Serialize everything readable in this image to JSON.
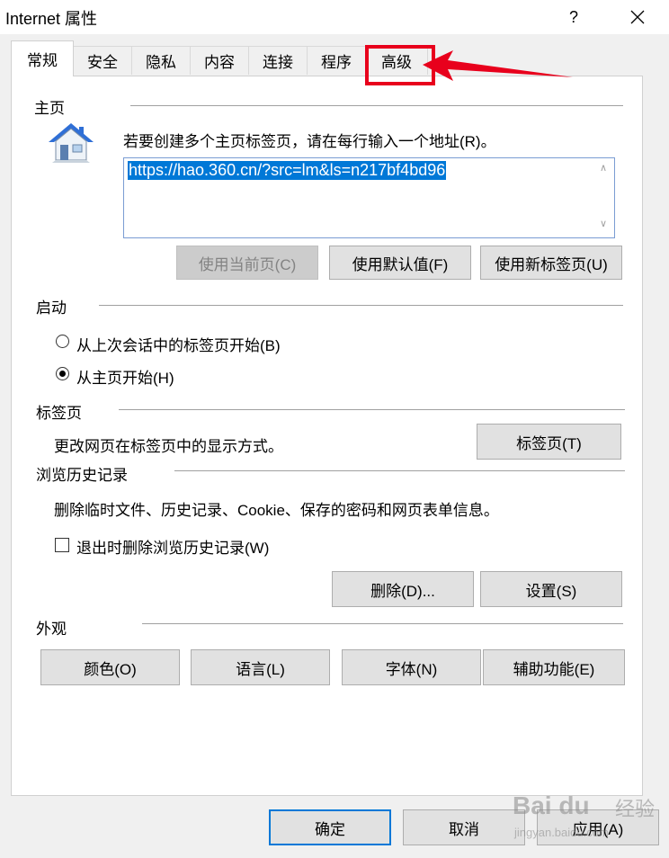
{
  "window": {
    "title": "Internet 属性",
    "help_label": "?"
  },
  "tabs": [
    {
      "label": "常规",
      "active": true
    },
    {
      "label": "安全"
    },
    {
      "label": "隐私"
    },
    {
      "label": "内容"
    },
    {
      "label": "连接"
    },
    {
      "label": "程序"
    },
    {
      "label": "高级"
    }
  ],
  "home": {
    "section_label": "主页",
    "instruction": "若要创建多个主页标签页，请在每行输入一个地址(R)。",
    "url_value": "https://hao.360.cn/?src=lm&ls=n217bf4bd96",
    "use_current_label": "使用当前页(C)",
    "use_default_label": "使用默认值(F)",
    "use_new_tab_label": "使用新标签页(U)"
  },
  "startup": {
    "section_label": "启动",
    "option_last_session": "从上次会话中的标签页开始(B)",
    "option_home": "从主页开始(H)",
    "selected": "home"
  },
  "tabs_section": {
    "section_label": "标签页",
    "description": "更改网页在标签页中的显示方式。",
    "button_label": "标签页(T)"
  },
  "history": {
    "section_label": "浏览历史记录",
    "description": "删除临时文件、历史记录、Cookie、保存的密码和网页表单信息。",
    "delete_on_exit_label": "退出时删除浏览历史记录(W)",
    "delete_on_exit_checked": false,
    "delete_label": "删除(D)...",
    "settings_label": "设置(S)"
  },
  "appearance": {
    "section_label": "外观",
    "colors_label": "颜色(O)",
    "languages_label": "语言(L)",
    "fonts_label": "字体(N)",
    "accessibility_label": "辅助功能(E)"
  },
  "footer": {
    "ok_label": "确定",
    "cancel_label": "取消",
    "apply_label": "应用(A)"
  },
  "watermark": {
    "logo": "Bai du",
    "suffix": "经验",
    "url": "jingyan.baidu.com"
  },
  "colors": {
    "accent": "#0078d7",
    "annotation": "#e8001c"
  }
}
